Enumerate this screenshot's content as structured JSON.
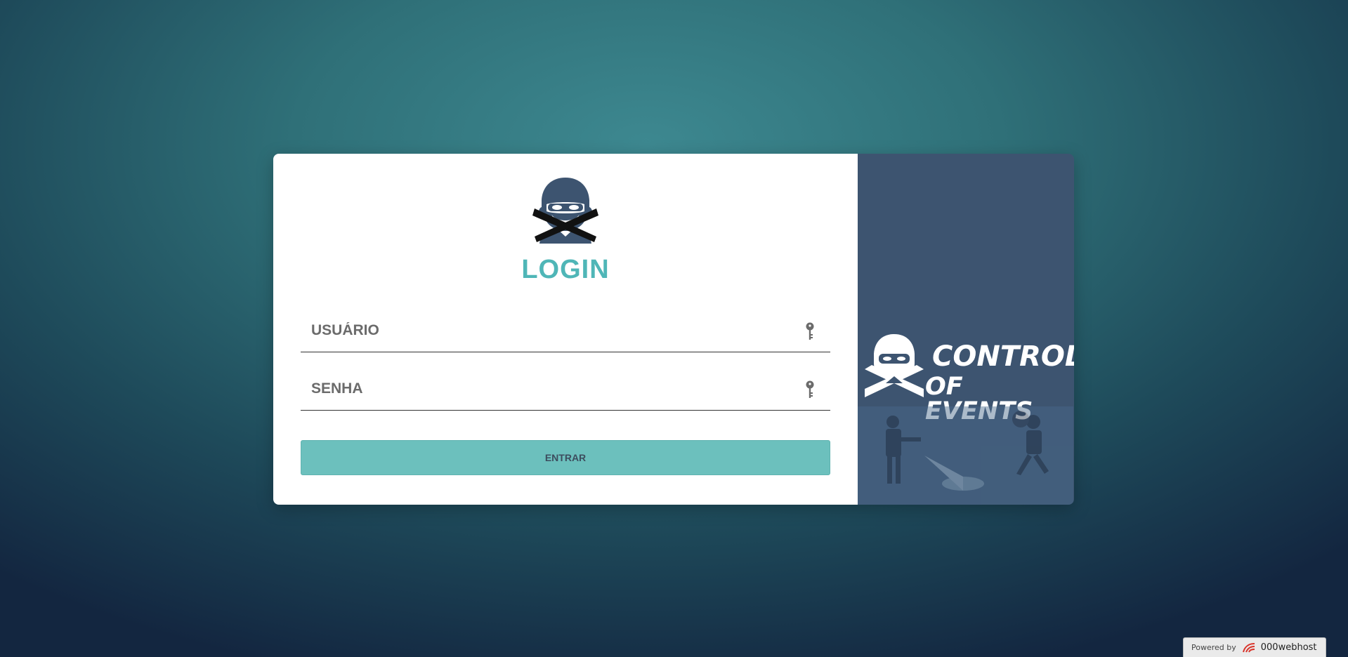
{
  "login": {
    "title": "LOGIN",
    "username_placeholder": "USUÁRIO",
    "password_placeholder": "SENHA",
    "submit_label": "ENTRAR"
  },
  "brand": {
    "line1": "CONTROL",
    "line2": "OF EVENTS"
  },
  "footer": {
    "powered_label": "Powered by",
    "host_name": "000webhost"
  },
  "icons": {
    "avatar": "masked-thief-icon",
    "username_field": "key-icon",
    "password_field": "key-icon",
    "host_logo": "webhost-logo-icon"
  },
  "colors": {
    "accent": "#4fb6b7",
    "button": "#6cc0bd",
    "side_panel": "#3d5470",
    "avatar_dark": "#3d5470"
  }
}
